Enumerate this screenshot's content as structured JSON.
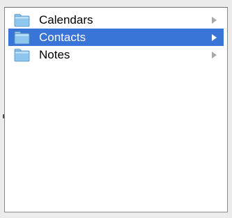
{
  "browser": {
    "items": [
      {
        "label": "Calendars",
        "icon": "folder-icon",
        "selected": false,
        "has_children": true
      },
      {
        "label": "Contacts",
        "icon": "folder-icon",
        "selected": true,
        "has_children": true
      },
      {
        "label": "Notes",
        "icon": "folder-icon",
        "selected": false,
        "has_children": true
      }
    ]
  },
  "colors": {
    "selection": "#3875d7",
    "folder": "#8fc6ee",
    "disclosure_arrow": "#a8a8a8"
  }
}
